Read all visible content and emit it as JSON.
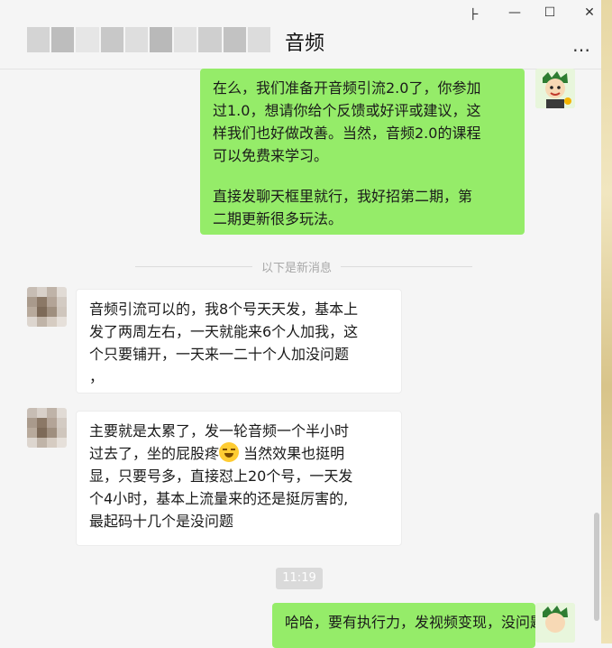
{
  "window": {
    "title": "音频",
    "pin_glyph": "⺊",
    "minimize_glyph": "—",
    "maximize_glyph": "☐",
    "close_glyph": "✕",
    "more_glyph": "…"
  },
  "messages": [
    {
      "from": "me",
      "lines": [
        "在么，我们准备开音频引流2.0了，你参加",
        "过1.0，想请你给个反馈或好评或建议，这",
        "样我们也好做改善。当然，音频2.0的课程",
        "可以免费来学习。",
        "",
        "直接发聊天框里就行，我好招第二期，第",
        "二期更新很多玩法。"
      ]
    },
    {
      "from": "them",
      "lines": [
        "音频引流可以的，我8个号天天发，基本上",
        "发了两周左右，一天就能来6个人加我，这",
        "个只要铺开，一天来一二十个人加没问题",
        "，"
      ]
    },
    {
      "from": "them",
      "lines": [
        "主要就是太累了，发一轮音频一个半小时",
        "过去了，坐的屁股疼",
        "当然效果也挺明",
        "显，只要号多，直接怼上20个号，一天发",
        "个4小时，基本上流量来的还是挺厉害的,",
        "最起码十几个是没问题"
      ]
    },
    {
      "from": "me",
      "lines": [
        "哈哈，要有执行力，发视频变现，没问题"
      ]
    }
  ],
  "divider_label": "以下是新消息",
  "timestamp": "11:19",
  "colors": {
    "my_bubble": "#95ec69",
    "their_bubble": "#ffffff",
    "background": "#f5f5f5"
  },
  "icons": [
    "pin-icon",
    "minimize-icon",
    "maximize-icon",
    "close-icon",
    "more-icon",
    "grin-sweat-emoji-icon"
  ]
}
